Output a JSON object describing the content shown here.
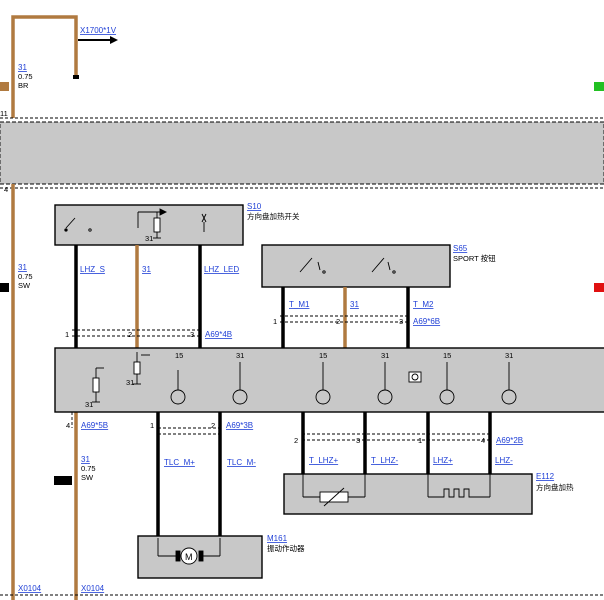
{
  "top_connector": {
    "label": "X1700*1V"
  },
  "ground_wire_top": {
    "num": "31",
    "gauge": "0.75",
    "color": "BR"
  },
  "pin_top_left": "11",
  "pin_left_4": "4",
  "s10": {
    "id": "S10",
    "desc": "方向盘加热开关",
    "ground": "31"
  },
  "s65": {
    "id": "S65",
    "desc": "SPORT 按钮"
  },
  "ground_wire_mid": {
    "num": "31",
    "gauge": "0.75",
    "color": "SW"
  },
  "ground_wire_low": {
    "num": "31",
    "gauge": "0.75",
    "color": "SW"
  },
  "s10_wires": [
    "LHZ_S",
    "31",
    "LHZ_LED"
  ],
  "s65_wires": [
    "T_M1",
    "31",
    "T_M2"
  ],
  "conn_a69_4b": {
    "label": "A69*4B",
    "pins": [
      "1",
      "2",
      "3"
    ]
  },
  "conn_a69_6b": {
    "label": "A69*6B",
    "pins": [
      "1",
      "2",
      "3"
    ]
  },
  "conn_a69_5b": {
    "label": "A69*5B",
    "pin": "4"
  },
  "conn_a69_3b": {
    "label": "A69*3B",
    "pins": [
      "1",
      "2"
    ]
  },
  "conn_a69_2b": {
    "label": "A69*2B",
    "pins": [
      "2",
      "3",
      "1",
      "4"
    ]
  },
  "module_supply": {
    "v15": "15",
    "v31": "31"
  },
  "tlc_wires": [
    "TLC_M+",
    "TLC_M-"
  ],
  "e112_wires": [
    "T_LHZ+",
    "T_LHZ-",
    "LHZ+",
    "LHZ-"
  ],
  "e112": {
    "id": "E112",
    "desc": "方向盘加热"
  },
  "m161": {
    "id": "M161",
    "desc": "振动作动器"
  },
  "bottom_connectors": [
    "X0104",
    "X0104"
  ],
  "colors": {
    "wire_black": "#000000",
    "wire_brown": "#b07a40",
    "box_fill": "#c8c8c8",
    "link_blue": "#1f3fd6",
    "edge_green": "#22c022",
    "edge_red": "#e01010"
  }
}
